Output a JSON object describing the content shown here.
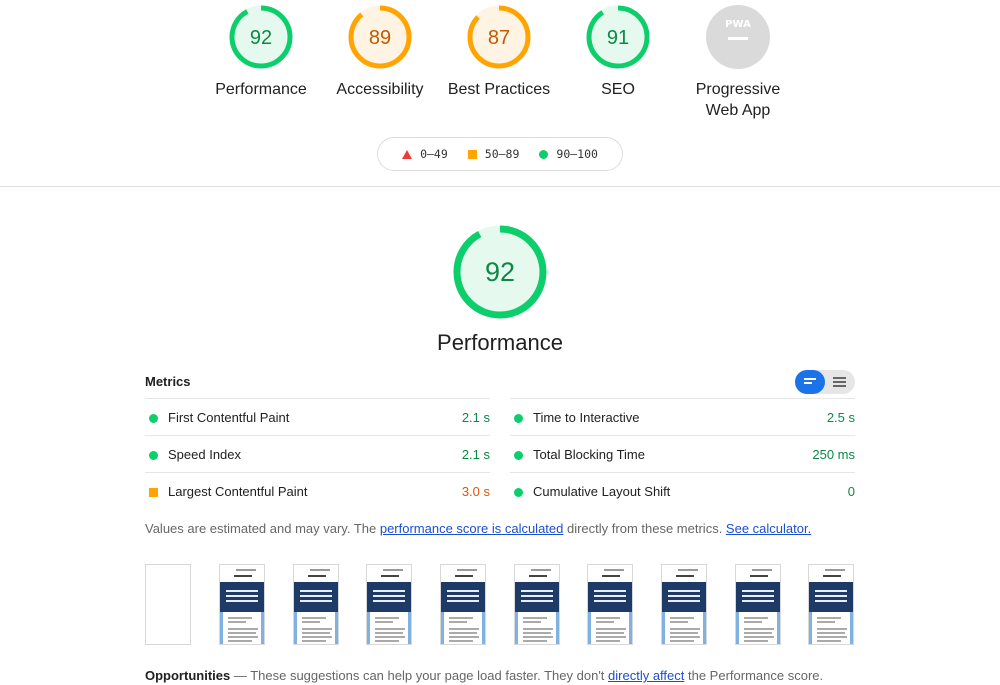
{
  "categories": [
    {
      "label": "Performance",
      "score": "92",
      "status": "pass"
    },
    {
      "label": "Accessibility",
      "score": "89",
      "status": "average"
    },
    {
      "label": "Best Practices",
      "score": "87",
      "status": "average"
    },
    {
      "label": "SEO",
      "score": "91",
      "status": "pass"
    },
    {
      "label_line1": "Progressive",
      "label_line2": "Web App",
      "badge": "PWA",
      "status": "na"
    }
  ],
  "legend": {
    "fail": "0–49",
    "average": "50–89",
    "pass": "90–100"
  },
  "performance": {
    "score": "92",
    "title": "Performance"
  },
  "metrics": {
    "heading": "Metrics",
    "items": [
      {
        "name": "First Contentful Paint",
        "value": "2.1 s",
        "status": "pass"
      },
      {
        "name": "Time to Interactive",
        "value": "2.5 s",
        "status": "pass"
      },
      {
        "name": "Speed Index",
        "value": "2.1 s",
        "status": "pass"
      },
      {
        "name": "Total Blocking Time",
        "value": "250 ms",
        "status": "pass"
      },
      {
        "name": "Largest Contentful Paint",
        "value": "3.0 s",
        "status": "average"
      },
      {
        "name": "Cumulative Layout Shift",
        "value": "0",
        "status": "pass"
      }
    ]
  },
  "note": {
    "prefix": "Values are estimated and may vary. The ",
    "link1": "performance score is calculated",
    "middle": " directly from these metrics. ",
    "link2": "See calculator."
  },
  "opportunities": {
    "title": "Opportunities",
    "prefix": " — These suggestions can help your page load faster. They don't ",
    "link": "directly affect",
    "suffix": " the Performance score."
  },
  "colors": {
    "pass": "#0cce6b",
    "pass_text": "#0a8a45",
    "pass_bg": "#e6f9ef",
    "average": "#ffa400",
    "average_text": "#c25a00",
    "average_bg": "#fff4e3",
    "fail": "#eb3f35",
    "na": "#c8c8c8"
  }
}
